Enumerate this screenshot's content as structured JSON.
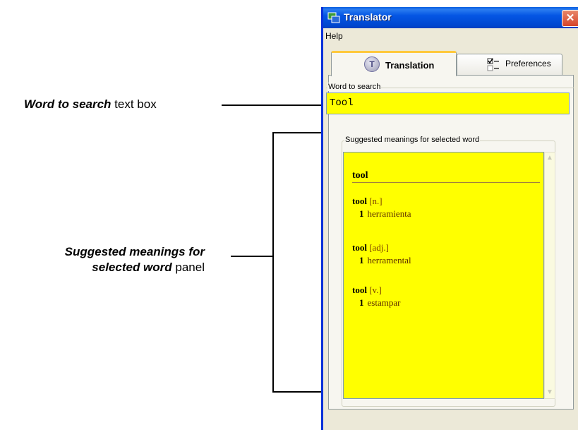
{
  "annotations": {
    "word_box": {
      "bold": "Word to search",
      "rest": " text box"
    },
    "meanings_panel": {
      "bold1": "Suggested meanings for",
      "bold2": "selected word",
      "rest": " panel"
    }
  },
  "window": {
    "title": "Translator",
    "close_glyph": "✕",
    "menu": {
      "help": "Help"
    }
  },
  "tabs": {
    "translation": {
      "label": "Translation",
      "icon_glyph": "T"
    },
    "preferences": {
      "label": "Preferences"
    }
  },
  "search": {
    "group_label": "Word to search",
    "value": "Tool"
  },
  "meanings": {
    "group_label": "Suggested meanings for selected word",
    "headword": "tool",
    "entries": [
      {
        "word": "tool",
        "pos": "[n.]",
        "num": "1",
        "meaning": "herramienta"
      },
      {
        "word": "tool",
        "pos": "[adj.]",
        "num": "1",
        "meaning": "herramental"
      },
      {
        "word": "tool",
        "pos": "[v.]",
        "num": "1",
        "meaning": "estampar"
      }
    ]
  },
  "colors": {
    "highlight": "#ffff00",
    "titlebar": "#0456e4",
    "tab_accent": "#ffc83c"
  }
}
